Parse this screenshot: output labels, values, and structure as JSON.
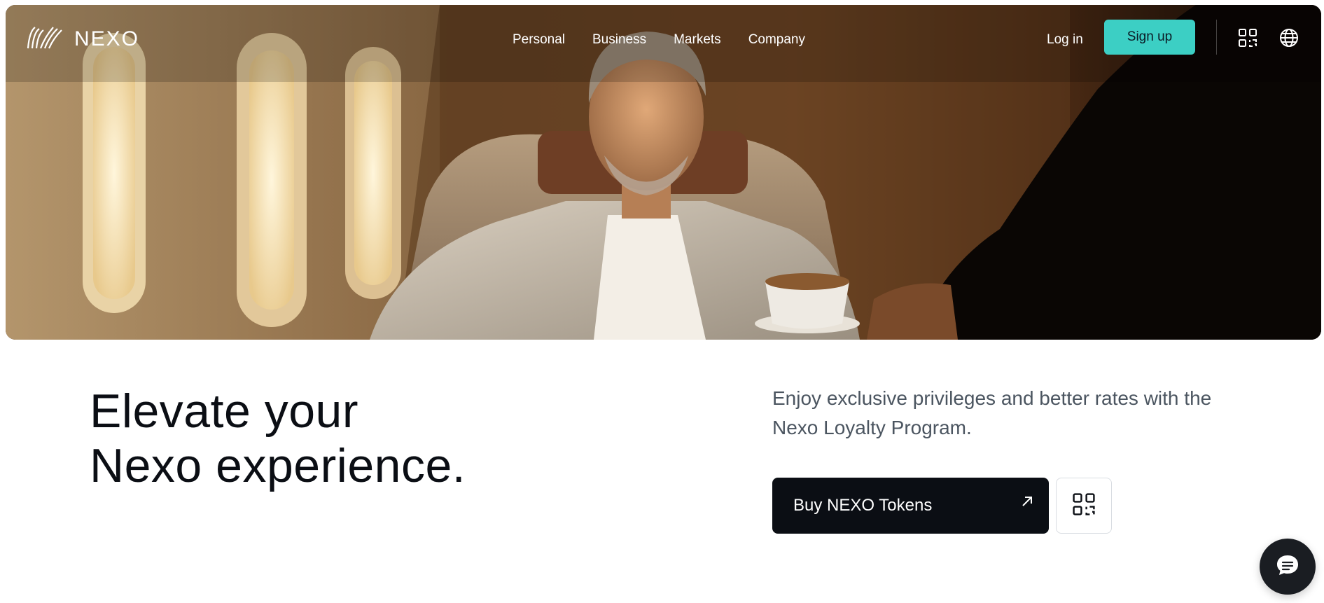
{
  "brand": {
    "name": "NEXO",
    "logo_icon": "nexo-wave-logo-icon"
  },
  "nav": {
    "links": [
      {
        "label": "Personal"
      },
      {
        "label": "Business"
      },
      {
        "label": "Markets"
      },
      {
        "label": "Company"
      }
    ],
    "login_label": "Log in",
    "signup_label": "Sign up",
    "icons": [
      "qr-code-icon",
      "globe-icon"
    ]
  },
  "hero": {
    "image": "man-in-private-jet-holding-coffee-cup"
  },
  "content": {
    "headline_line1": "Elevate your",
    "headline_line2": "Nexo experience.",
    "description": "Enjoy exclusive privileges and better rates with the Nexo Loyalty Program.",
    "buy_button_label": "Buy NEXO Tokens",
    "buy_button_icon": "arrow-up-right-icon",
    "qr_button_icon": "qr-code-icon"
  },
  "chat": {
    "icon": "chat-bubble-icon"
  },
  "colors": {
    "accent": "#3ccfc4",
    "dark": "#0b0e14",
    "text_muted": "#4b5560"
  }
}
